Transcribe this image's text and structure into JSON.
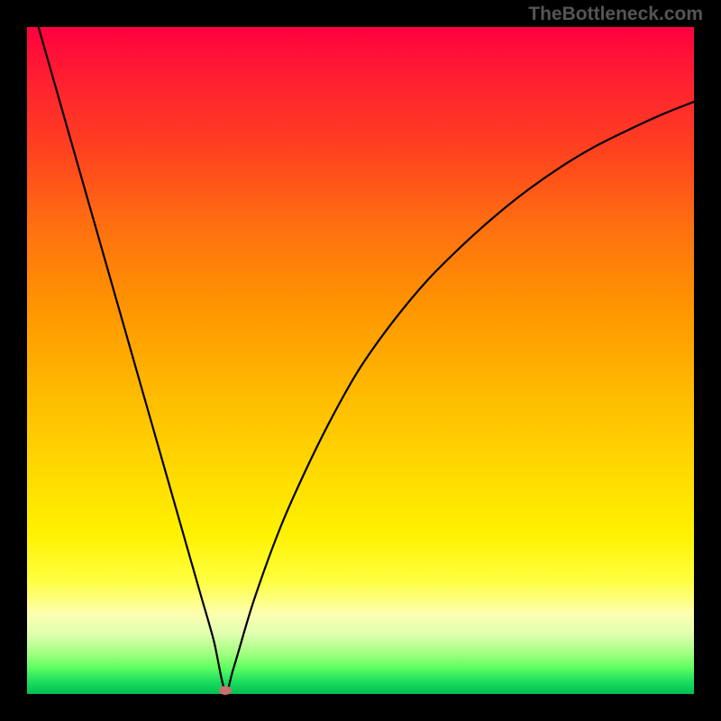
{
  "watermark": "TheBottleneck.com",
  "chart_data": {
    "type": "line",
    "title": "",
    "xlabel": "",
    "ylabel": "",
    "xlim": [
      0,
      100
    ],
    "ylim": [
      0,
      100
    ],
    "grid": false,
    "legend": false,
    "background": "gradient-red-to-green",
    "series": [
      {
        "name": "bottleneck-curve",
        "x": [
          0,
          2,
          5,
          8,
          11,
          14,
          17,
          20,
          23,
          26,
          28,
          29.7,
          31,
          34,
          38,
          42,
          46,
          50,
          55,
          60,
          65,
          70,
          75,
          80,
          85,
          90,
          95,
          100
        ],
        "y": [
          106,
          99,
          88.5,
          78,
          67.5,
          57,
          46.5,
          36,
          25.5,
          15,
          8,
          0.5,
          4,
          14,
          25,
          34,
          42,
          49,
          56,
          62,
          67,
          71.5,
          75.5,
          79,
          82,
          84.5,
          86.8,
          88.8
        ]
      }
    ],
    "marker": {
      "x": 29.7,
      "y": 0.5,
      "color": "#c97070"
    }
  }
}
